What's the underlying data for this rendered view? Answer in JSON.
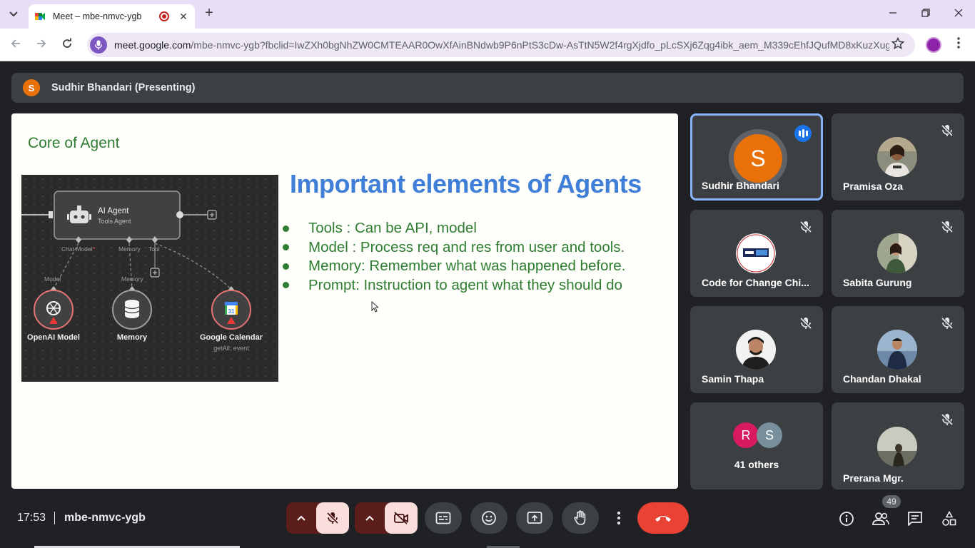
{
  "browser": {
    "tab_title": "Meet – mbe-nmvc-ygb",
    "tab_close": "✕",
    "new_tab": "+",
    "url_host": "meet.google.com",
    "url_path": "/mbe-nmvc-ygb?fbclid=IwZXh0bgNhZW0CMTEAAR0OwXfAinBNdwb9P6nPtS3cDw-AsTtN5W2f4rgXjdfo_pLcSXj6Zqg4ibk_aem_M339cEhfJQufMD8xKuzXug"
  },
  "presenter": {
    "initial": "S",
    "label": "Sudhir Bhandari (Presenting)"
  },
  "slide": {
    "heading": "Core of Agent",
    "title": "Important elements of Agents",
    "bullets": [
      "Tools : Can be API, model",
      "Model : Process req and res from user and tools.",
      "Memory: Remember what was happened before.",
      "Prompt: Instruction to agent what they should do"
    ],
    "diagram": {
      "agent_title": "AI Agent",
      "agent_subtitle": "Tools Agent",
      "port_chat_model": "Chat Model",
      "port_required": "*",
      "port_memory": "Memory",
      "port_tool": "Tool",
      "edge_model": "Model",
      "edge_memory": "Memory",
      "node_openai": "OpenAI Model",
      "node_memory": "Memory",
      "node_calendar": "Google Calendar",
      "node_calendar_sub": "getAll: event",
      "calendar_day": "31"
    }
  },
  "participants": [
    {
      "name": "Sudhir Bhandari",
      "initial": "S",
      "speaking": true
    },
    {
      "name": "Pramisa Oza",
      "muted": true
    },
    {
      "name": "Code for Change Chi...",
      "muted": true
    },
    {
      "name": "Sabita Gurung",
      "muted": true
    },
    {
      "name": "Samin Thapa",
      "muted": true
    },
    {
      "name": "Chandan Dhakal",
      "muted": true
    },
    {
      "name": "41 others",
      "initials": [
        "R",
        "S"
      ]
    },
    {
      "name": "Prerana Mgr.",
      "muted": true
    }
  ],
  "bottom": {
    "time": "17:53",
    "meeting_code": "mbe-nmvc-ygb",
    "people_count": "49"
  },
  "colors": {
    "slide_heading": "#2e7d32",
    "slide_title": "#3f7fd8",
    "active_border": "#8ab4f8",
    "end_call": "#ea4335",
    "presenter_avatar": "#e8710a"
  }
}
